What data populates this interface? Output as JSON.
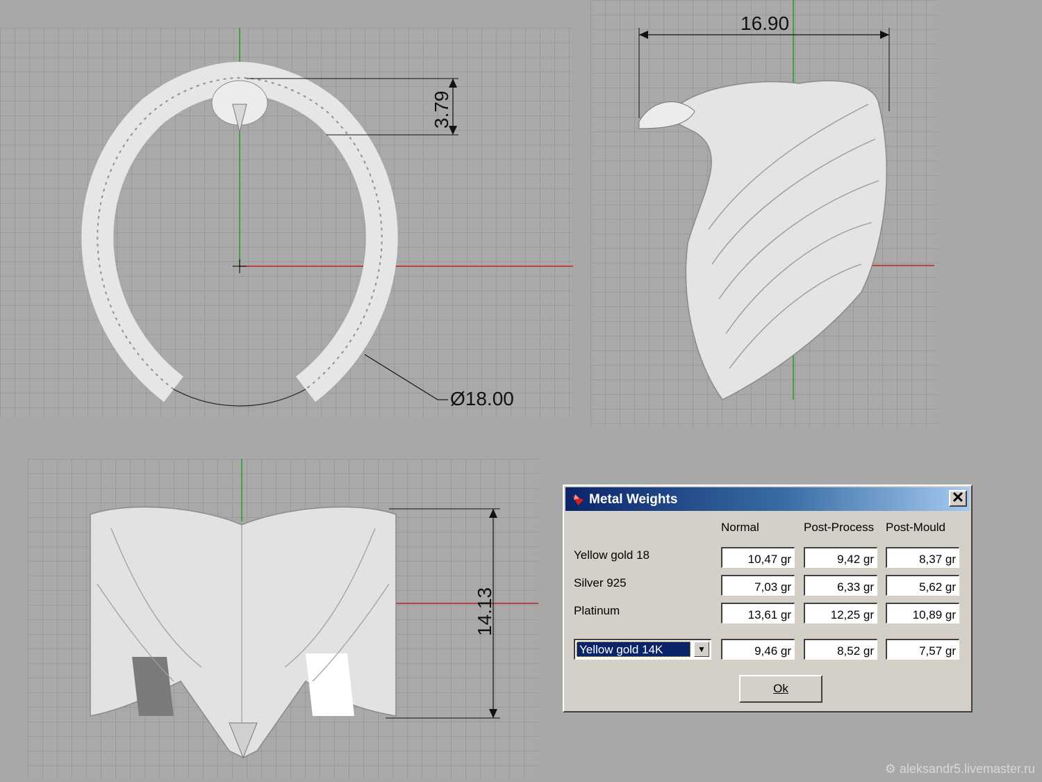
{
  "views": {
    "top_dimensions": {
      "height": "3.79",
      "diameter": "Ø18.00"
    },
    "side_dimensions": {
      "width": "16.90"
    },
    "front_dimensions": {
      "height": "14.13"
    }
  },
  "dialog": {
    "title": "Metal Weights",
    "close_glyph": "✕",
    "columns": [
      "Normal",
      "Post-Process",
      "Post-Mould"
    ],
    "rows": [
      {
        "label": "Yellow gold 18",
        "values": [
          "10,47 gr",
          "9,42 gr",
          "8,37 gr"
        ]
      },
      {
        "label": "Silver 925",
        "values": [
          "7,03 gr",
          "6,33 gr",
          "5,62 gr"
        ]
      },
      {
        "label": "Platinum",
        "values": [
          "13,61 gr",
          "12,25 gr",
          "10,89 gr"
        ]
      }
    ],
    "custom_row": {
      "selected_metal": "Yellow gold 14K",
      "values": [
        "9,46 gr",
        "8,52 gr",
        "7,57 gr"
      ]
    },
    "ok_label": "Ok"
  },
  "watermark": "aleksandr5.livemaster.ru",
  "colors": {
    "titlebar_start": "#0a246a",
    "axis_red": "#c02020",
    "axis_green": "#20a020"
  }
}
